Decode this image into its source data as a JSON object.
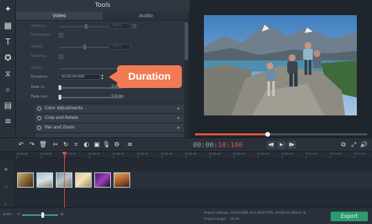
{
  "tools_panel": {
    "title": "Tools",
    "tabs": [
      {
        "label": "Video",
        "active": true
      },
      {
        "label": "Audio",
        "active": false
      }
    ],
    "properties": [
      {
        "label": "Volume:",
        "value": "100%",
        "enabled": false
      },
      {
        "label": "Normalize:",
        "enabled": false
      },
      {
        "label": "Speed:",
        "value": "100%",
        "enabled": false
      },
      {
        "label": "Reverse:",
        "enabled": false
      },
      {
        "label": "Duration:",
        "value": "00:00:04.000",
        "enabled": true
      },
      {
        "label": "Fade in:",
        "value": "0.0 sec.",
        "enabled": true
      },
      {
        "label": "Fade out:",
        "value": "0.0 sec.",
        "enabled": true
      }
    ],
    "sections": [
      {
        "label": "Color Adjustments"
      },
      {
        "label": "Crop and Rotate"
      },
      {
        "label": "Pan and Zoom"
      }
    ]
  },
  "callout": {
    "label": "Duration",
    "color": "#f27b55"
  },
  "rail_icons": [
    "magic-wand-icon",
    "film-icon",
    "text-icon",
    "star-icon",
    "transition-icon",
    "zoom-icon",
    "grid-icon",
    "menu-icon"
  ],
  "preview": {
    "progress": 0.42,
    "accent": "#e0573b"
  },
  "toolbar": {
    "time_prefix": "00:00:",
    "time_current": "10:100"
  },
  "timeline": {
    "ticks": [
      "00:00:00",
      "00:00:05",
      "00:00:10",
      "00:00:15",
      "00:00:20",
      "00:00:25",
      "00:00:30",
      "00:00:35",
      "00:00:40",
      "00:00:45",
      "00:00:50",
      "00:00:55",
      "00:01:00",
      "00:01:05",
      "00:01:10"
    ],
    "clips": [
      {
        "name": "clip-1"
      },
      {
        "name": "clip-2"
      },
      {
        "name": "clip-3"
      },
      {
        "name": "clip-4"
      },
      {
        "name": "clip-5"
      },
      {
        "name": "clip-6"
      }
    ]
  },
  "status": {
    "scale_label": "Scale:",
    "settings_label": "Project settings:",
    "settings_value": "1920x1080 16:9 29.97 FPS, 44100 Hz Stereo",
    "length_label": "Project length:",
    "length_value": "00:34"
  },
  "export_label": "Export",
  "export_color": "#2b9c6b"
}
